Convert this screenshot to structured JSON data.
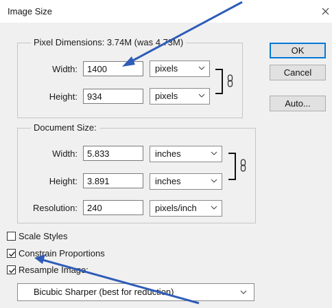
{
  "window": {
    "title": "Image Size"
  },
  "pixel_dimensions": {
    "legend": "Pixel Dimensions:  3.74M (was 4.73M)",
    "width_label": "Width:",
    "width_value": "1400",
    "width_unit": "pixels",
    "height_label": "Height:",
    "height_value": "934",
    "height_unit": "pixels"
  },
  "document_size": {
    "legend": "Document Size:",
    "width_label": "Width:",
    "width_value": "5.833",
    "width_unit": "inches",
    "height_label": "Height:",
    "height_value": "3.891",
    "height_unit": "inches",
    "resolution_label": "Resolution:",
    "resolution_value": "240",
    "resolution_unit": "pixels/inch"
  },
  "buttons": {
    "ok": "OK",
    "cancel": "Cancel",
    "auto": "Auto..."
  },
  "options": {
    "scale_styles": {
      "label": "Scale Styles",
      "checked": false
    },
    "constrain": {
      "label": "Constrain Proportions",
      "checked": true
    },
    "resample": {
      "label": "Resample Image:",
      "checked": true
    },
    "resample_method": "Bicubic Sharper (best for reduction)"
  },
  "colors": {
    "annotation_arrow": "#2e5cb8",
    "default_button_border": "#0078d7"
  },
  "icons": {
    "link": "chain-link-icon",
    "close": "close-icon",
    "dropdown": "chevron-down-icon"
  }
}
